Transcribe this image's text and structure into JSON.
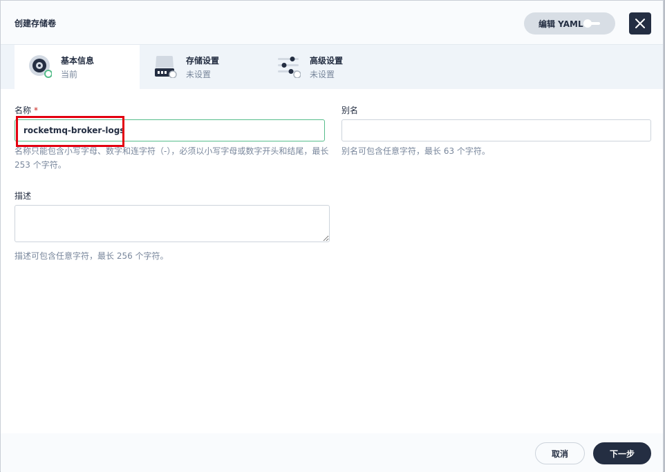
{
  "dialog": {
    "title": "创建存储卷",
    "yaml_toggle_label": "编辑 YAML",
    "yaml_toggle_on": false
  },
  "steps": [
    {
      "name": "基本信息",
      "state": "当前",
      "icon": "disk-icon",
      "active": true
    },
    {
      "name": "存储设置",
      "state": "未设置",
      "icon": "storage-drive-icon",
      "active": false
    },
    {
      "name": "高级设置",
      "state": "未设置",
      "icon": "sliders-icon",
      "active": false
    }
  ],
  "form": {
    "name": {
      "label": "名称",
      "required_mark": "*",
      "value": "rocketmq-broker-logs",
      "hint": "名称只能包含小写字母、数字和连字符（-），必须以小写字母或数字开头和结尾，最长 253 个字符。"
    },
    "alias": {
      "label": "别名",
      "value": "",
      "hint": "别名可包含任意字符，最长 63 个字符。"
    },
    "description": {
      "label": "描述",
      "value": "",
      "hint": "描述可包含任意字符，最长 256 个字符。"
    }
  },
  "footer": {
    "cancel_label": "取消",
    "next_label": "下一步"
  },
  "colors": {
    "primary_dark": "#242e42",
    "success_green": "#55bc8a",
    "muted_text": "#79879c",
    "highlight_red": "#e3000f"
  }
}
